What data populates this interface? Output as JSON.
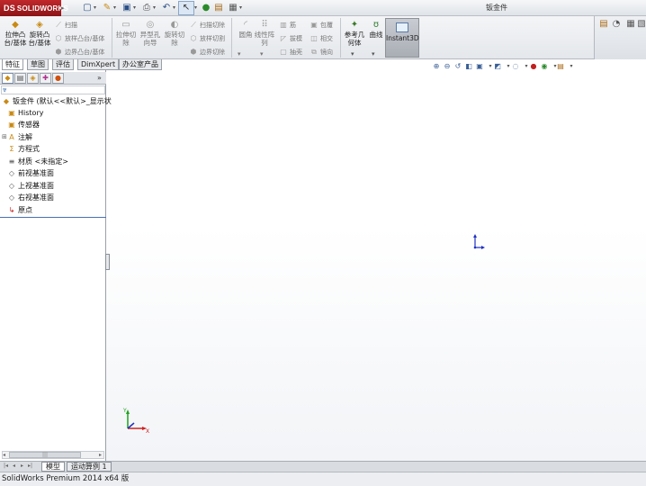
{
  "app": {
    "logo_text": "SOLIDWORKS",
    "logo_mark": "DS",
    "document_title": "钣金件"
  },
  "quick_access": {
    "icons": [
      "new-file-icon",
      "open-file-icon",
      "save-icon",
      "print-icon",
      "undo-icon",
      "rebuild-icon",
      "select-icon",
      "file-properties-icon",
      "options-icon"
    ]
  },
  "command_manager": {
    "big_buttons": {
      "extruded_boss": "拉伸凸台/基体",
      "revolved_boss": "旋转凸台/基体",
      "extruded_cut": "拉伸切除",
      "hole_wizard": "异型孔向导",
      "revolved_cut": "旋转切除",
      "fillet": "圆角",
      "linear_pattern": "线性阵列",
      "reference_geometry": "参考几何体",
      "curves": "曲线",
      "instant3d": "Instant3D"
    },
    "small_buttons": {
      "swept_boss": "扫描",
      "lofted_boss": "放样凸台/基体",
      "boundary_boss": "边界凸台/基体",
      "swept_cut": "扫描切除",
      "lofted_cut": "放样切割",
      "boundary_cut": "边界切除",
      "rib": "筋",
      "draft": "拔模",
      "shell": "抽壳",
      "wrap": "包覆",
      "intersect": "相交",
      "mirror": "镜向"
    }
  },
  "command_tabs": [
    "特征",
    "草图",
    "评估",
    "DimXpert",
    "办公室产品"
  ],
  "feature_tree": {
    "root": "钣金件 (默认<<默认>_显示状",
    "items": [
      {
        "label": "History",
        "icon": "history-folder-icon"
      },
      {
        "label": "传感器",
        "icon": "sensors-folder-icon"
      },
      {
        "label": "注解",
        "icon": "annotations-icon",
        "expandable": true
      },
      {
        "label": "方程式",
        "icon": "equations-icon"
      },
      {
        "label": "材质 <未指定>",
        "icon": "material-icon"
      },
      {
        "label": "前视基准面",
        "icon": "plane-icon"
      },
      {
        "label": "上视基准面",
        "icon": "plane-icon"
      },
      {
        "label": "右视基准面",
        "icon": "plane-icon"
      },
      {
        "label": "原点",
        "icon": "origin-icon"
      }
    ]
  },
  "bottom_tabs": [
    "模型",
    "运动算例 1"
  ],
  "status_bar": {
    "text": "SolidWorks Premium 2014 x64 版"
  },
  "colors": {
    "logo_red": "#b3201f",
    "accent_blue": "#2a4f86",
    "triad_x": "#d02020",
    "triad_y": "#20a020",
    "triad_z": "#2030c0"
  }
}
